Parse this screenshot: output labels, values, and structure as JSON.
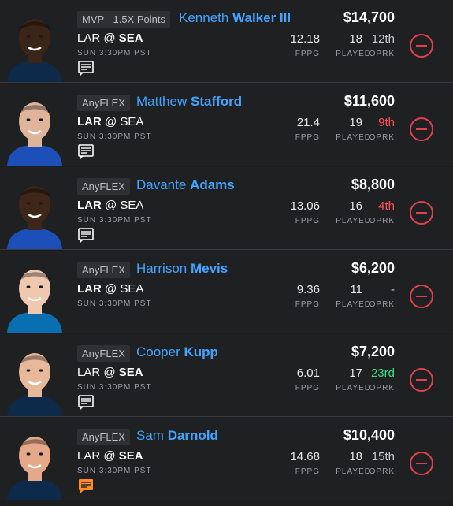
{
  "players": [
    {
      "badge": "MVP - 1.5X Points",
      "first_name": "Kenneth",
      "last_name": "Walker III",
      "salary": "$14,700",
      "away": "LAR",
      "at": "@",
      "home": "SEA",
      "bold_team": "home",
      "game_time": "SUN 3:30PM PST",
      "fppg": "12.18",
      "played": "18",
      "oprk": "12th",
      "oprk_color": "#c9cbcf",
      "fppg_label": "FPPG",
      "played_label": "PLAYED",
      "oprk_label": "OPRK",
      "note_icon": "note-icon",
      "note_color": "#ffffff",
      "jersey_color": "#0d2a4a",
      "skin_color": "#3b2418"
    },
    {
      "badge": "AnyFLEX",
      "first_name": "Matthew",
      "last_name": "Stafford",
      "salary": "$11,600",
      "away": "LAR",
      "at": "@",
      "home": "SEA",
      "bold_team": "away",
      "game_time": "SUN 3:30PM PST",
      "fppg": "21.4",
      "played": "19",
      "oprk": "9th",
      "oprk_color": "#ff4d5a",
      "fppg_label": "FPPG",
      "played_label": "PLAYED",
      "oprk_label": "OPRK",
      "note_icon": "note-icon",
      "note_color": "#ffffff",
      "jersey_color": "#1d4fb8",
      "skin_color": "#e0b49a"
    },
    {
      "badge": "AnyFLEX",
      "first_name": "Davante",
      "last_name": "Adams",
      "salary": "$8,800",
      "away": "LAR",
      "at": "@",
      "home": "SEA",
      "bold_team": "away",
      "game_time": "SUN 3:30PM PST",
      "fppg": "13.06",
      "played": "16",
      "oprk": "4th",
      "oprk_color": "#ff4d5a",
      "fppg_label": "FPPG",
      "played_label": "PLAYED",
      "oprk_label": "OPRK",
      "note_icon": "note-icon",
      "note_color": "#ffffff",
      "jersey_color": "#1d4fb8",
      "skin_color": "#3e2618"
    },
    {
      "badge": "AnyFLEX",
      "first_name": "Harrison",
      "last_name": "Mevis",
      "salary": "$6,200",
      "away": "LAR",
      "at": "@",
      "home": "SEA",
      "bold_team": "away",
      "game_time": "SUN 3:30PM PST",
      "fppg": "9.36",
      "played": "11",
      "oprk": "-",
      "oprk_color": "#c9cbcf",
      "fppg_label": "FPPG",
      "played_label": "PLAYED",
      "oprk_label": "OPRK",
      "note_icon": "",
      "note_color": "#ffffff",
      "jersey_color": "#0a6fb0",
      "skin_color": "#f0c8b0"
    },
    {
      "badge": "AnyFLEX",
      "first_name": "Cooper",
      "last_name": "Kupp",
      "salary": "$7,200",
      "away": "LAR",
      "at": "@",
      "home": "SEA",
      "bold_team": "home",
      "game_time": "SUN 3:30PM PST",
      "fppg": "6.01",
      "played": "17",
      "oprk": "23rd",
      "oprk_color": "#3ddc84",
      "fppg_label": "FPPG",
      "played_label": "PLAYED",
      "oprk_label": "OPRK",
      "note_icon": "note-icon",
      "note_color": "#ffffff",
      "jersey_color": "#0d2a4a",
      "skin_color": "#e7b89a"
    },
    {
      "badge": "AnyFLEX",
      "first_name": "Sam",
      "last_name": "Darnold",
      "salary": "$10,400",
      "away": "LAR",
      "at": "@",
      "home": "SEA",
      "bold_team": "home",
      "game_time": "SUN 3:30PM PST",
      "fppg": "14.68",
      "played": "18",
      "oprk": "15th",
      "oprk_color": "#c9cbcf",
      "fppg_label": "FPPG",
      "played_label": "PLAYED",
      "oprk_label": "OPRK",
      "note_icon": "note-icon",
      "note_color": "#ff8a2b",
      "jersey_color": "#0d2a4a",
      "skin_color": "#e5a98a"
    }
  ]
}
